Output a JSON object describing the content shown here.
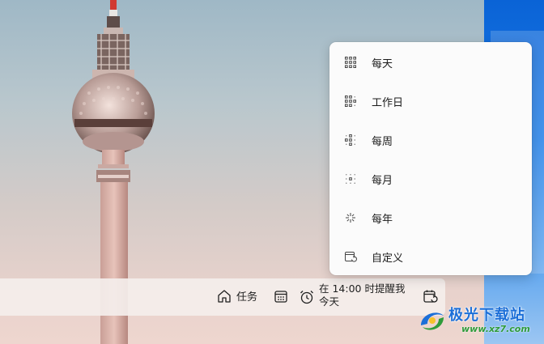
{
  "menu": {
    "items": [
      {
        "label": "每天",
        "icon": "daily-grid-icon"
      },
      {
        "label": "工作日",
        "icon": "weekday-grid-icon"
      },
      {
        "label": "每周",
        "icon": "weekly-grid-icon"
      },
      {
        "label": "每月",
        "icon": "monthly-grid-icon"
      },
      {
        "label": "每年",
        "icon": "yearly-sparkle-icon"
      },
      {
        "label": "自定义",
        "icon": "custom-calendar-repeat-icon"
      }
    ]
  },
  "taskbar": {
    "task_label": "任务",
    "reminder_line1": "在 14:00 时提醒我",
    "reminder_line2": "今天"
  },
  "watermark": {
    "text": "极光下载站",
    "url": "www.xz7.com"
  },
  "colors": {
    "menu_bg": "#fbfbfb",
    "watermark_blue": "#1c6fd8",
    "watermark_green": "#2e9b3a",
    "desktop_blue": "#0a63d6"
  }
}
